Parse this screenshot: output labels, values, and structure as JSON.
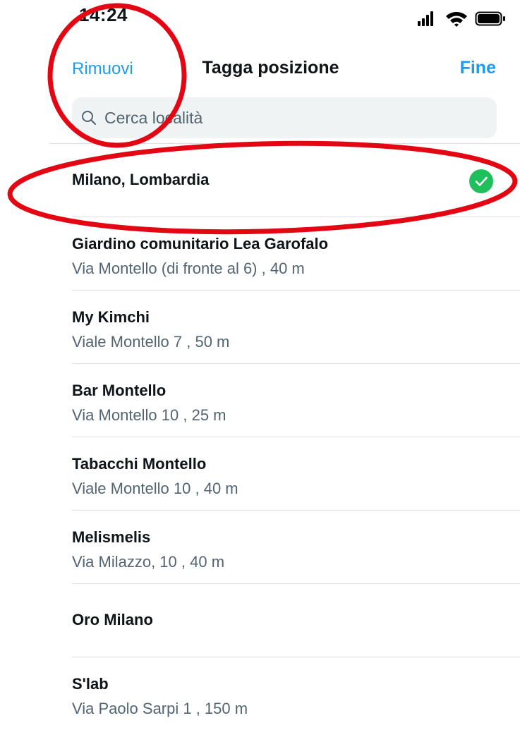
{
  "status_bar": {
    "time": "14:24",
    "icons": [
      "signal-icon",
      "wifi-icon",
      "battery-icon"
    ]
  },
  "nav": {
    "left_label": "Rimuovi",
    "title": "Tagga posizione",
    "right_label": "Fine"
  },
  "search": {
    "placeholder": "Cerca località",
    "value": ""
  },
  "locations": [
    {
      "name": "Milano, Lombardia",
      "detail": "",
      "selected": true
    },
    {
      "name": "Giardino comunitario Lea Garofalo",
      "detail": "Via Montello (di fronte al 6) , 40 m",
      "selected": false
    },
    {
      "name": "My Kimchi",
      "detail": "Viale Montello 7 , 50 m",
      "selected": false
    },
    {
      "name": "Bar Montello",
      "detail": "Via Montello 10 , 25 m",
      "selected": false
    },
    {
      "name": "Tabacchi Montello",
      "detail": "Viale Montello 10 , 40 m",
      "selected": false
    },
    {
      "name": "Melismelis",
      "detail": "Via Milazzo, 10 , 40 m",
      "selected": false
    },
    {
      "name": "Oro Milano",
      "detail": "",
      "selected": false
    },
    {
      "name": "S'lab",
      "detail": "Via Paolo Sarpi 1 , 150 m",
      "selected": false
    }
  ],
  "colors": {
    "accent": "#1d9bf0",
    "check": "#1fbf5c",
    "annotation": "#e30613",
    "secondary_text": "#536471"
  }
}
